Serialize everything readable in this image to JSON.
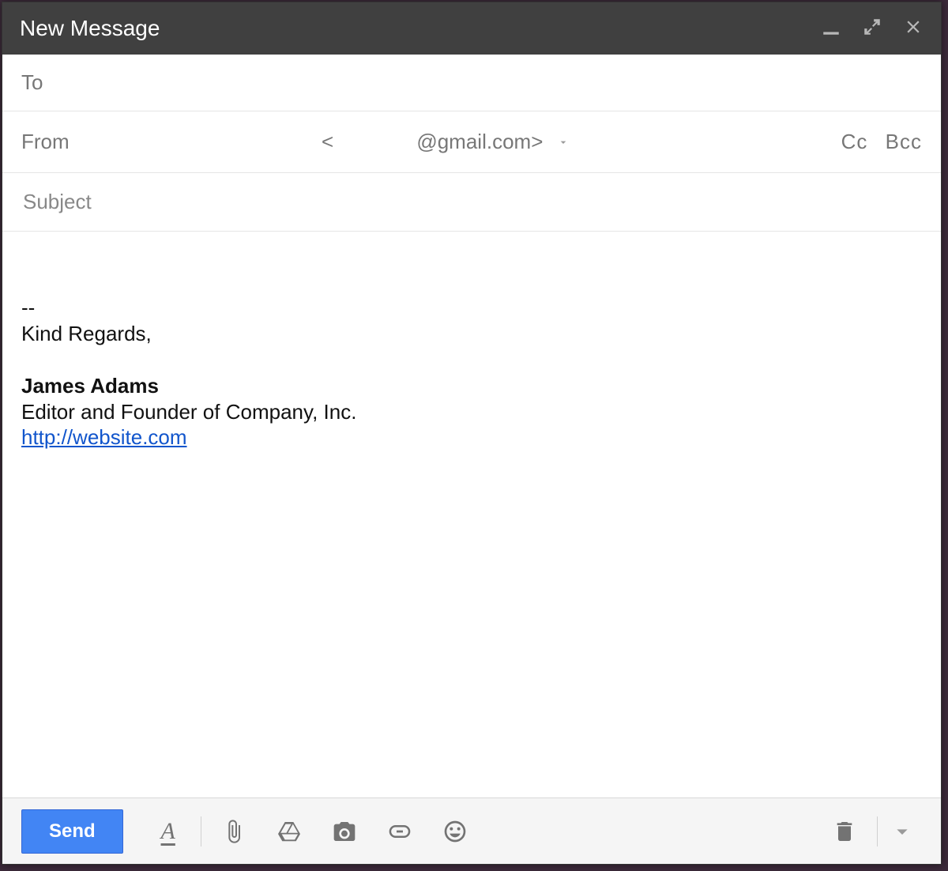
{
  "window": {
    "title": "New Message"
  },
  "fields": {
    "to_label": "To",
    "from_label": "From",
    "from_email_display": "@gmail.com>",
    "from_angle_open": "<",
    "cc_label": "Cc",
    "bcc_label": "Bcc",
    "subject_placeholder": "Subject"
  },
  "body": {
    "sep": "--",
    "closing": "Kind Regards,",
    "name": "James Adams",
    "title_line": "Editor and Founder of Company, Inc.",
    "link_text": "http://website.com"
  },
  "toolbar": {
    "send_label": "Send"
  }
}
